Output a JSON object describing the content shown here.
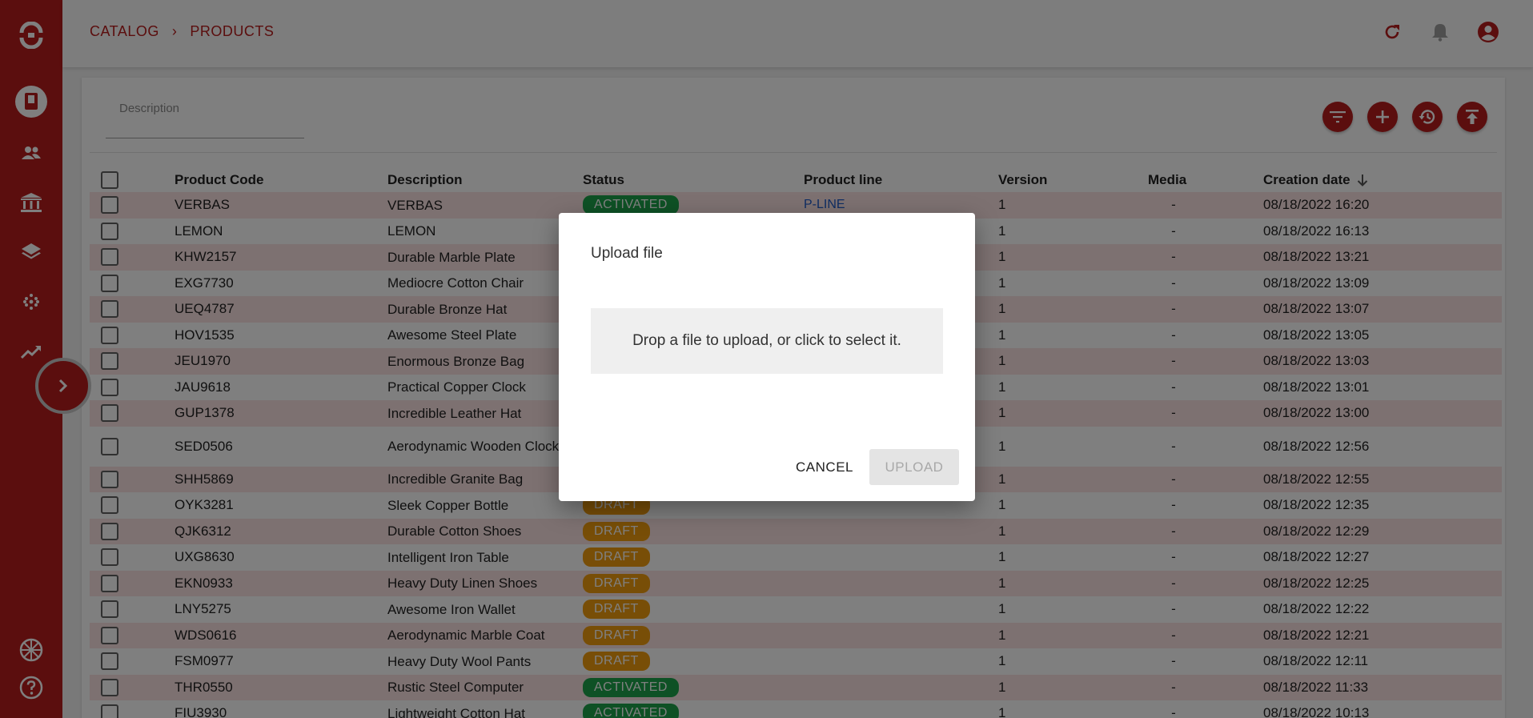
{
  "breadcrumb": {
    "root": "CATALOG",
    "separator": "›",
    "current": "PRODUCTS"
  },
  "filter": {
    "label": "Description",
    "value": ""
  },
  "table": {
    "headers": {
      "code": "Product Code",
      "description": "Description",
      "status": "Status",
      "product_line": "Product line",
      "version": "Version",
      "media": "Media",
      "creation_date": "Creation date"
    },
    "rows": [
      {
        "code": "VERBAS",
        "description": "VERBAS",
        "status": "ACTIVATED",
        "product_line": "P-LINE",
        "version": "1",
        "media": "-",
        "date": "08/18/2022 16:20"
      },
      {
        "code": "LEMON",
        "description": "LEMON",
        "status": "",
        "product_line": "",
        "version": "1",
        "media": "-",
        "date": "08/18/2022 16:13"
      },
      {
        "code": "KHW2157",
        "description": "Durable Marble Plate",
        "status": "",
        "product_line": "",
        "version": "1",
        "media": "-",
        "date": "08/18/2022 13:21"
      },
      {
        "code": "EXG7730",
        "description": "Mediocre Cotton Chair",
        "status": "",
        "product_line": "",
        "version": "1",
        "media": "-",
        "date": "08/18/2022 13:09"
      },
      {
        "code": "UEQ4787",
        "description": "Durable Bronze Hat",
        "status": "",
        "product_line": "",
        "version": "1",
        "media": "-",
        "date": "08/18/2022 13:07"
      },
      {
        "code": "HOV1535",
        "description": "Awesome Steel Plate",
        "status": "",
        "product_line": "",
        "version": "1",
        "media": "-",
        "date": "08/18/2022 13:05"
      },
      {
        "code": "JEU1970",
        "description": "Enormous Bronze Bag",
        "status": "",
        "product_line": "",
        "version": "1",
        "media": "-",
        "date": "08/18/2022 13:03"
      },
      {
        "code": "JAU9618",
        "description": "Practical Copper Clock",
        "status": "",
        "product_line": "",
        "version": "1",
        "media": "-",
        "date": "08/18/2022 13:01"
      },
      {
        "code": "GUP1378",
        "description": "Incredible Leather Hat",
        "status": "",
        "product_line": "",
        "version": "1",
        "media": "-",
        "date": "08/18/2022 13:00"
      },
      {
        "code": "SED0506",
        "description": "Aerodynamic Wooden Clock",
        "status": "",
        "product_line": "",
        "version": "1",
        "media": "-",
        "date": "08/18/2022 12:56"
      },
      {
        "code": "SHH5869",
        "description": "Incredible Granite Bag",
        "status": "",
        "product_line": "",
        "version": "1",
        "media": "-",
        "date": "08/18/2022 12:55"
      },
      {
        "code": "OYK3281",
        "description": "Sleek Copper Bottle",
        "status": "DRAFT",
        "product_line": "",
        "version": "1",
        "media": "-",
        "date": "08/18/2022 12:35"
      },
      {
        "code": "QJK6312",
        "description": "Durable Cotton Shoes",
        "status": "DRAFT",
        "product_line": "",
        "version": "1",
        "media": "-",
        "date": "08/18/2022 12:29"
      },
      {
        "code": "UXG8630",
        "description": "Intelligent Iron Table",
        "status": "DRAFT",
        "product_line": "",
        "version": "1",
        "media": "-",
        "date": "08/18/2022 12:27"
      },
      {
        "code": "EKN0933",
        "description": "Heavy Duty Linen Shoes",
        "status": "DRAFT",
        "product_line": "",
        "version": "1",
        "media": "-",
        "date": "08/18/2022 12:25"
      },
      {
        "code": "LNY5275",
        "description": "Awesome Iron Wallet",
        "status": "DRAFT",
        "product_line": "",
        "version": "1",
        "media": "-",
        "date": "08/18/2022 12:22"
      },
      {
        "code": "WDS0616",
        "description": "Aerodynamic Marble Coat",
        "status": "DRAFT",
        "product_line": "",
        "version": "1",
        "media": "-",
        "date": "08/18/2022 12:21"
      },
      {
        "code": "FSM0977",
        "description": "Heavy Duty Wool Pants",
        "status": "DRAFT",
        "product_line": "",
        "version": "1",
        "media": "-",
        "date": "08/18/2022 12:11"
      },
      {
        "code": "THR0550",
        "description": "Rustic Steel Computer",
        "status": "ACTIVATED",
        "product_line": "",
        "version": "1",
        "media": "-",
        "date": "08/18/2022 11:33"
      },
      {
        "code": "FIU3930",
        "description": "Lightweight Cotton Hat",
        "status": "ACTIVATED",
        "product_line": "",
        "version": "1",
        "media": "-",
        "date": "08/18/2022 10:13"
      }
    ]
  },
  "dialog": {
    "title": "Upload file",
    "dropzone_text": "Drop a file to upload, or click to select it.",
    "cancel_label": "CANCEL",
    "upload_label": "UPLOAD"
  },
  "icons": {
    "sidebar": [
      "app-logo-icon",
      "catalog-icon",
      "users-icon",
      "institution-icon",
      "layers-icon",
      "grid-dots-icon",
      "trending-icon",
      "language-uk-icon",
      "help-icon"
    ],
    "top": [
      "refresh-icon",
      "bell-icon",
      "account-icon"
    ],
    "card": [
      "filter-icon",
      "add-icon",
      "history-icon",
      "upload-icon"
    ]
  },
  "colors": {
    "brand": "#b71c1c",
    "activated": "#1ca34a",
    "draft": "#f19c0e",
    "link": "#1e5bc6",
    "row_shade": "#fbe3e3"
  }
}
